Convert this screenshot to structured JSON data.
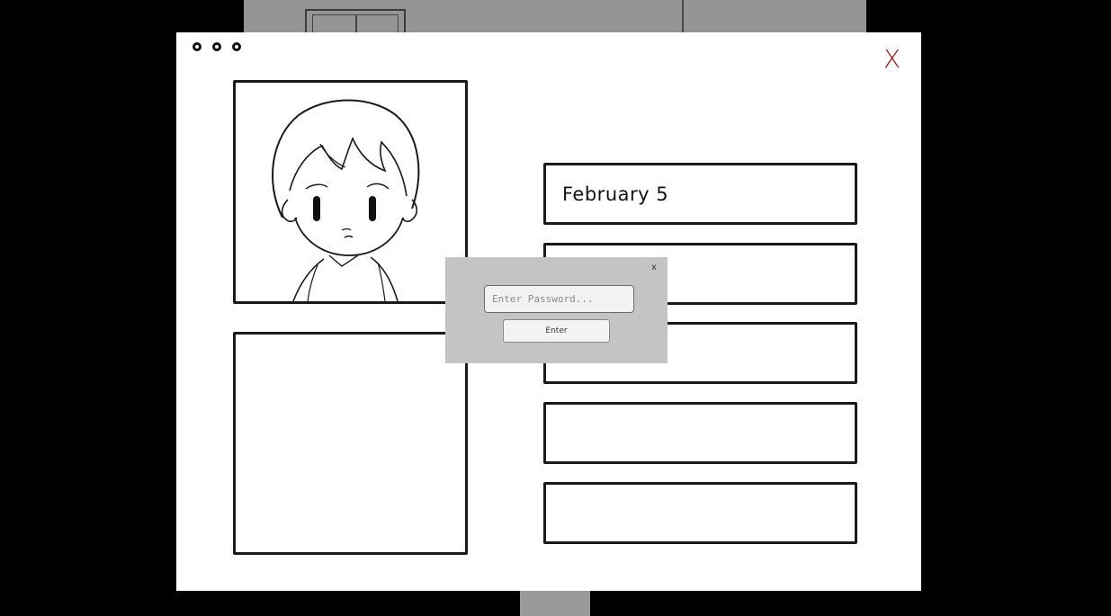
{
  "window": {
    "close_label": "X"
  },
  "profile": {
    "date_field": "February 5",
    "fields": [
      "",
      "",
      "",
      ""
    ]
  },
  "dialog": {
    "close_label": "x",
    "password_placeholder": "Enter Password...",
    "password_value": "",
    "enter_label": "Enter"
  },
  "colors": {
    "close_x": "#8b1c1c",
    "dialog_bg": "#c4c4c4"
  }
}
